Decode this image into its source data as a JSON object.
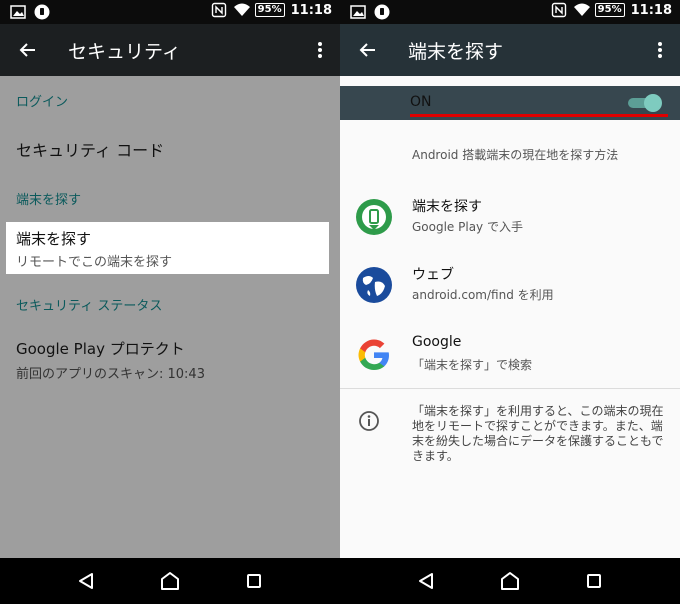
{
  "status_bar": {
    "time_left": "11:18",
    "time_right": "11:18",
    "battery": "95%",
    "icons": [
      "image-icon",
      "shield-notification-icon",
      "nfc-icon",
      "wifi-icon",
      "battery-icon"
    ]
  },
  "left": {
    "app_bar": {
      "title": "セキュリティ",
      "back_icon": "arrow-back-icon",
      "more_icon": "more-vert-icon"
    },
    "sections": {
      "login": "ログイン",
      "find_device": "端末を探す",
      "security_status": "セキュリティ ステータス"
    },
    "items": {
      "security_code": "セキュリティ コード",
      "find_device_primary": "端末を探す",
      "find_device_secondary": "リモートでこの端末を探す",
      "play_protect_primary": "Google Play プロテクト",
      "play_protect_secondary": "前回のアプリのスキャン: 10:43"
    },
    "colors": {
      "background": "#9e9e9e",
      "section": "#0b5a5c",
      "highlight": "#ffffff"
    }
  },
  "right": {
    "app_bar": {
      "title": "端末を探す",
      "back_icon": "arrow-back-icon",
      "more_icon": "more-vert-icon"
    },
    "switch": {
      "label": "ON",
      "state": true
    },
    "description": "Android 搭載端末の現在地を探す方法",
    "options": [
      {
        "icon": "find-device-app-icon",
        "primary": "端末を探す",
        "secondary": "Google Play で入手"
      },
      {
        "icon": "globe-icon",
        "primary": "ウェブ",
        "secondary": "android.com/find を利用"
      },
      {
        "icon": "google-g-icon",
        "primary": "Google",
        "secondary": "「端末を探す」で検索"
      }
    ],
    "info": "「端末を探す」を利用すると、この端末の現在地をリモートで探すことができます。また、端末を紛失した場合にデータを保護することもできます。",
    "colors": {
      "app_bar": "#263238",
      "switch_bar": "#37474f",
      "toggle": "#7ecbbf",
      "underline": "#e00000"
    }
  },
  "nav": {
    "back": "nav-back-icon",
    "home": "nav-home-icon",
    "recents": "nav-recents-icon"
  }
}
